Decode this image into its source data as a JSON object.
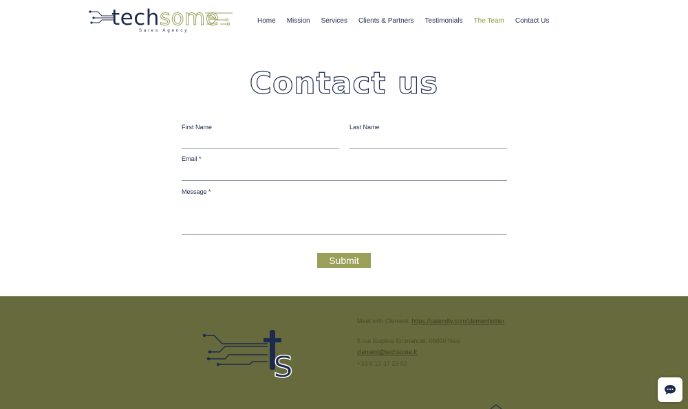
{
  "logo": {
    "word_first": "tech",
    "word_second": "some",
    "tagline": "Sales Agency",
    "icon": "circuit-logo-icon"
  },
  "nav": {
    "items": [
      {
        "label": "Home",
        "active": false
      },
      {
        "label": "Mission",
        "active": false
      },
      {
        "label": "Services",
        "active": false
      },
      {
        "label": "Clients & Partners",
        "active": false
      },
      {
        "label": "Testimonials",
        "active": false
      },
      {
        "label": "The Team",
        "active": true
      },
      {
        "label": "Contact Us",
        "active": false
      }
    ]
  },
  "page": {
    "title": "Contact us"
  },
  "form": {
    "first_name_label": "First Name",
    "first_name_value": "",
    "last_name_label": "Last Name",
    "last_name_value": "",
    "email_label": "Email *",
    "email_value": "",
    "message_label": "Message *",
    "message_value": "",
    "submit_label": "Submit"
  },
  "footer": {
    "meet_text": "Meet with Clement: ",
    "meet_link": "https://calendly.com/clementlottier",
    "address": "5 rue Eugène Emmanuel, 06000 Nice",
    "email": "clement@techsome.fr",
    "phone": "+33 6 13 37 23 82",
    "logo_icon": "ts-circuit-logo-icon"
  },
  "chat": {
    "icon": "chat-bubble-icon"
  },
  "colors": {
    "navy": "#1c2a4e",
    "olive_accent": "#9aa05a",
    "footer_bg": "#666a3c",
    "active_nav": "#8d9a42"
  }
}
